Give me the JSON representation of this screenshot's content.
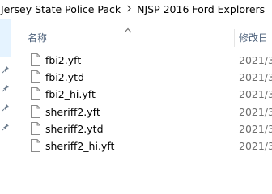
{
  "breadcrumb": {
    "items": [
      "Jersey State Police Pack",
      "NJSP 2016 Ford Explorers"
    ],
    "separator_icon": "chevron-right-icon"
  },
  "nav": {
    "pins": [
      "pin-icon",
      "pin-icon",
      "pin-icon",
      "pin-icon"
    ]
  },
  "columns": {
    "name": "名称",
    "modified": "修改日"
  },
  "sort": {
    "column": "name",
    "direction": "ascending",
    "icon": "chevron-up-icon"
  },
  "files": [
    {
      "name": "fbi2.yft",
      "date": "2021/3",
      "icon": "file-icon"
    },
    {
      "name": "fbi2.ytd",
      "date": "2021/3",
      "icon": "file-icon"
    },
    {
      "name": "fbi2_hi.yft",
      "date": "2021/3",
      "icon": "file-icon"
    },
    {
      "name": "sheriff2.yft",
      "date": "2021/3",
      "icon": "file-icon"
    },
    {
      "name": "sheriff2.ytd",
      "date": "2021/3",
      "icon": "file-icon"
    },
    {
      "name": "sheriff2_hi.yft",
      "date": "2021/3",
      "icon": "file-icon"
    }
  ],
  "colors": {
    "header_text": "#4c607a",
    "nav_hover": "#e5f3ff",
    "date_text": "#6d6d6d"
  }
}
